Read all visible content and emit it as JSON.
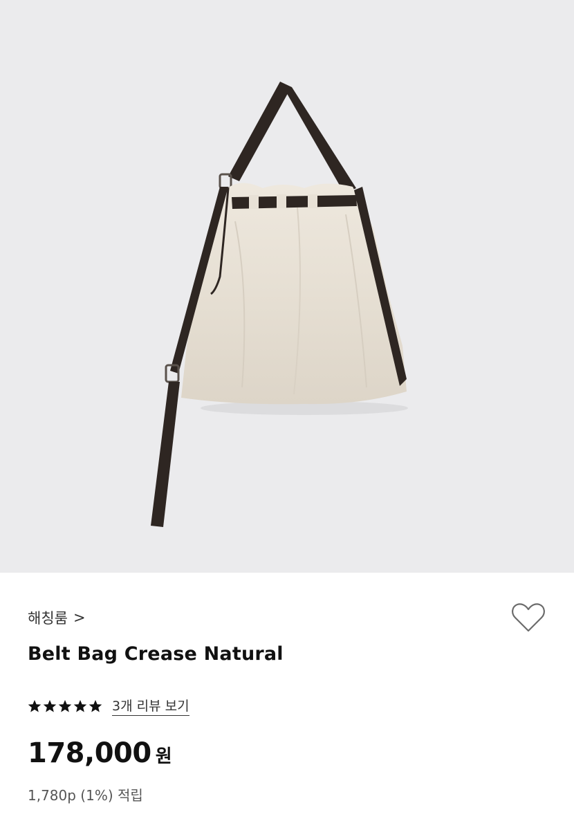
{
  "product": {
    "brand_label": "해칭룸",
    "brand_chevron": ">",
    "name": "Belt Bag Crease Natural",
    "rating": 5,
    "rating_max": 5,
    "review_link": "3개 리뷰 보기",
    "price_value": "178,000",
    "price_unit": "원",
    "points_text": "1,780p (1%) 적립"
  },
  "icons": {
    "wishlist": "heart-outline-icon",
    "star": "star-filled-icon",
    "brand_arrow": "chevron-right-icon"
  },
  "colors": {
    "hero_background": "#ebebed",
    "bag_canvas": "#e8e1d6",
    "strap": "#2e2622",
    "text_primary": "#111111",
    "text_secondary": "#555555"
  }
}
